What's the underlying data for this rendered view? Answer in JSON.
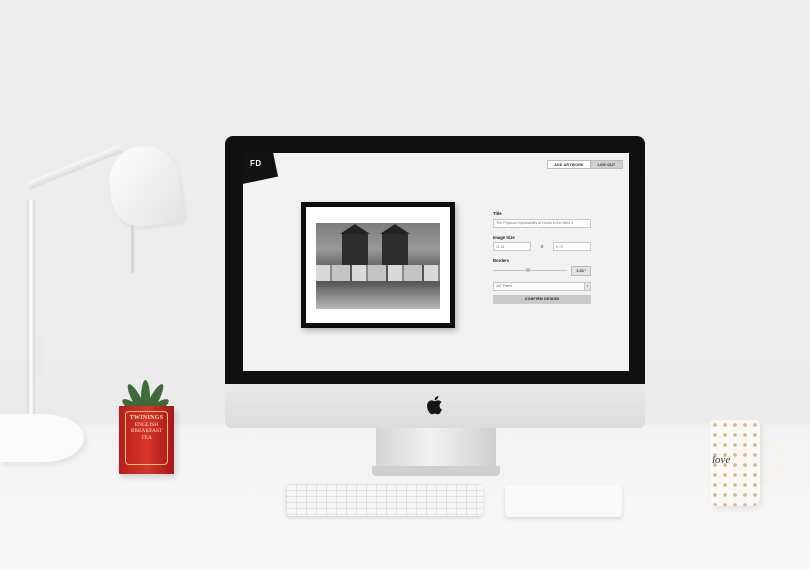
{
  "app": {
    "logo": "FD",
    "header": {
      "add_artwork_label": "ADD ARTWORK",
      "logout_label": "LOG OUT"
    },
    "form": {
      "title_label": "Title",
      "title_value": "The Physical Impossibility of Death in the Mind o",
      "image_size_label": "Image Size",
      "width_value": "11.81",
      "height_value": "9.72",
      "size_separator": "X",
      "borders_label": "Borders",
      "border_value": "1.01\"",
      "frame_select_value": "1/2\" Farm",
      "confirm_label": "CONFIRM DESIGN"
    }
  },
  "scene": {
    "tea_tin": {
      "brand": "TWININGS",
      "line1": "ENGLISH",
      "line2": "BREAKFAST",
      "line3": "TEA"
    },
    "mug_text": "love"
  },
  "colors": {
    "frame": "#0c0c0c",
    "confirm_button": "#c9c9c9",
    "screen_background": "#f2f2f2",
    "tea_tin": "#c52a23"
  }
}
